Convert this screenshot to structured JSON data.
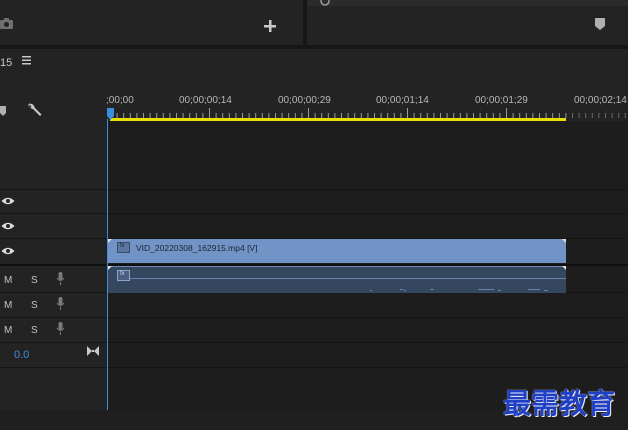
{
  "source_monitor": {
    "camera_icon": "camera-icon",
    "add_icon": "plus-icon"
  },
  "program_monitor": {
    "settings_icon": "ring-icon",
    "marker_icon": "marker-icon"
  },
  "timeline": {
    "sequence_number": "15",
    "menu_icon": "hamburger-icon",
    "ruler": {
      "timecodes": [
        ";00;00",
        "00;00;00;14",
        "00;00;00;29",
        "00;00;01;14",
        "00;00;01;29",
        "00;00;02;14"
      ]
    },
    "video_tracks": [
      {
        "eye_icon": "eye-icon"
      },
      {
        "eye_icon": "eye-icon"
      },
      {
        "eye_icon": "eye-icon"
      }
    ],
    "audio_tracks": [
      {
        "mute": "M",
        "solo": "S",
        "mic_icon": "microphone-icon"
      },
      {
        "mute": "M",
        "solo": "S",
        "mic_icon": "microphone-icon"
      },
      {
        "mute": "M",
        "solo": "S",
        "mic_icon": "microphone-icon"
      }
    ],
    "master_volume": "0.0",
    "video_clip": {
      "label": "VID_20220308_162915.mp4 [V]",
      "badge": "fx"
    },
    "audio_clip": {
      "badge": "fx"
    },
    "colors": {
      "playhead": "#3b8de0",
      "work_area": "#e6e000",
      "video_clip": "#7193c6",
      "audio_clip": "#35475f"
    }
  },
  "watermark": "最需教育"
}
